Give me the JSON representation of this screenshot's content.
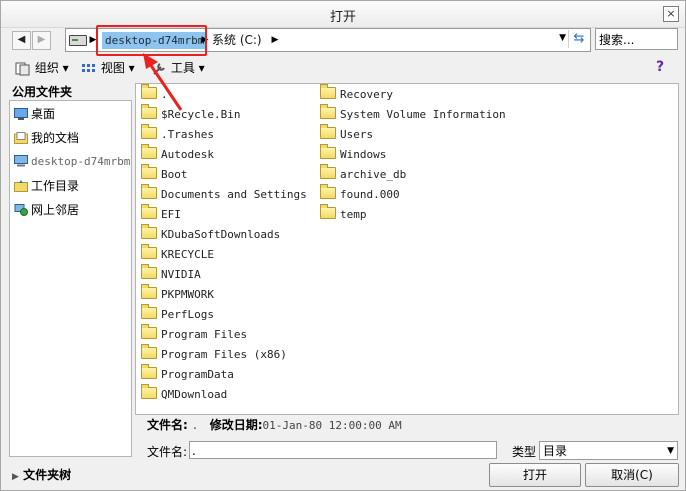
{
  "window": {
    "title": "打开",
    "close_symbol": "×"
  },
  "address": {
    "crumb_computer": "desktop-d74mrbm",
    "crumb_drive": "系统 (C:)",
    "separator": "▶",
    "dropdown_symbol": "▼",
    "refresh_symbol": "⇆"
  },
  "search": {
    "placeholder": "搜索..."
  },
  "nav": {
    "back_symbol": "◀",
    "forward_symbol": "▶"
  },
  "toolbar": {
    "organize_label": "组织",
    "view_label": "视图",
    "tools_label": "工具",
    "caret": "▾",
    "help_symbol": "?"
  },
  "places": {
    "header": "公用文件夹",
    "items": [
      "桌面",
      "我的文档",
      "desktop-d74mrbm",
      "工作目录",
      "网上邻居"
    ]
  },
  "files": {
    "column1": [
      ".",
      "$Recycle.Bin",
      ".Trashes",
      "Autodesk",
      "Boot",
      "Documents and Settings",
      "EFI",
      "KDubaSoftDownloads",
      "KRECYCLE",
      "NVIDIA",
      "PKPMWORK",
      "PerfLogs",
      "Program Files",
      "Program Files (x86)",
      "ProgramData",
      "QMDownload"
    ],
    "column2": [
      "Recovery",
      "System Volume Information",
      "Users",
      "Windows",
      "archive_db",
      "found.000",
      "temp"
    ]
  },
  "details": {
    "name_label": "文件名:",
    "name_value": ".",
    "modified_label": "修改日期:",
    "modified_value": "01-Jan-80 12:00:00 AM"
  },
  "filename": {
    "label": "文件名:",
    "value": "."
  },
  "filetype": {
    "label": "类型",
    "value": "目录",
    "dropdown_symbol": "▼"
  },
  "buttons": {
    "open_label": "打开",
    "cancel_label": "取消(C)"
  },
  "folder_tree": {
    "toggle_symbol": "▶",
    "label": "文件夹树"
  },
  "colors": {
    "accent_highlight": "#e8231f",
    "selection": "#8ec4ee"
  }
}
